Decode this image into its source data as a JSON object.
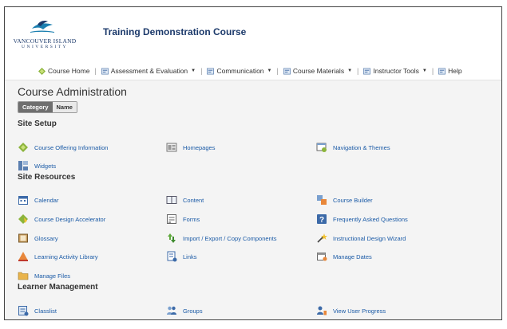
{
  "header": {
    "logo_line1": "VANCOUVER ISLAND",
    "logo_line2": "UNIVERSITY",
    "course_title": "Training Demonstration Course"
  },
  "nav": {
    "course_home": "Course Home",
    "assessment": "Assessment & Evaluation",
    "communication": "Communication",
    "course_materials": "Course Materials",
    "instructor_tools": "Instructor Tools",
    "help": "Help"
  },
  "page": {
    "title": "Course Administration",
    "toggle_category": "Category",
    "toggle_name": "Name"
  },
  "sections": {
    "site_setup": {
      "heading": "Site Setup",
      "tools": [
        "Course Offering Information",
        "Homepages",
        "Navigation & Themes",
        "Widgets"
      ]
    },
    "site_resources": {
      "heading": "Site Resources",
      "tools": [
        "Calendar",
        "Content",
        "Course Builder",
        "Course Design Accelerator",
        "Forms",
        "Frequently Asked Questions",
        "Glossary",
        "Import / Export / Copy Components",
        "Instructional Design Wizard",
        "Learning Activity Library",
        "Links",
        "Manage Dates",
        "Manage Files"
      ]
    },
    "learner_management": {
      "heading": "Learner Management",
      "tools": [
        "Classlist",
        "Groups",
        "View User Progress"
      ]
    }
  },
  "colors": {
    "brand_navy": "#1c3a6b",
    "link_blue": "#1a5aa6",
    "content_bg": "#f4f4f4"
  }
}
